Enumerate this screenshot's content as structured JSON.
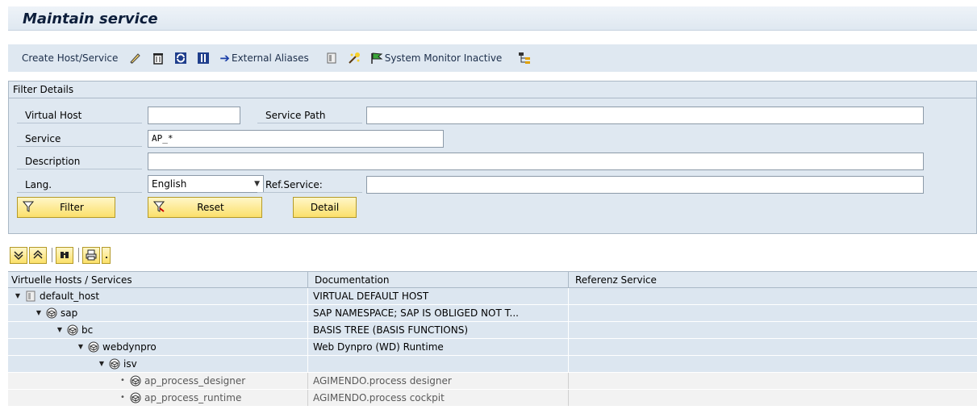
{
  "title": "Maintain service",
  "toolbar": {
    "create_label": "Create Host/Service",
    "external_aliases_label": "External Aliases",
    "system_monitor_label": "System Monitor Inactive"
  },
  "filter": {
    "header": "Filter Details",
    "virtual_host_label": "Virtual Host",
    "virtual_host_value": "",
    "service_path_label": "Service Path",
    "service_path_value": "",
    "service_label": "Service",
    "service_value": "AP_*",
    "description_label": "Description",
    "description_value": "",
    "lang_label": "Lang.",
    "lang_value": "English",
    "ref_service_label": "Ref.Service:",
    "ref_service_value": "",
    "filter_button": "Filter",
    "reset_button": "Reset",
    "detail_button": "Detail"
  },
  "grid": {
    "headers": [
      "Virtuelle Hosts / Services",
      "Documentation",
      "Referenz Service"
    ],
    "rows": [
      {
        "label": "default_host",
        "doc": "VIRTUAL DEFAULT HOST",
        "ref": ""
      },
      {
        "label": "sap",
        "doc": "SAP NAMESPACE; SAP IS OBLIGED NOT T...",
        "ref": ""
      },
      {
        "label": "bc",
        "doc": "BASIS TREE (BASIS FUNCTIONS)",
        "ref": ""
      },
      {
        "label": "webdynpro",
        "doc": "Web Dynpro (WD) Runtime",
        "ref": ""
      },
      {
        "label": "isv",
        "doc": "",
        "ref": ""
      },
      {
        "label": "ap_process_designer",
        "doc": "AGIMENDO.process designer",
        "ref": ""
      },
      {
        "label": "ap_process_runtime",
        "doc": "AGIMENDO.process cockpit",
        "ref": ""
      }
    ]
  },
  "colors": {
    "header_bg": "#dfe8f1",
    "button_yellow": "#fbe06a",
    "title_text": "#0d1e3b"
  }
}
